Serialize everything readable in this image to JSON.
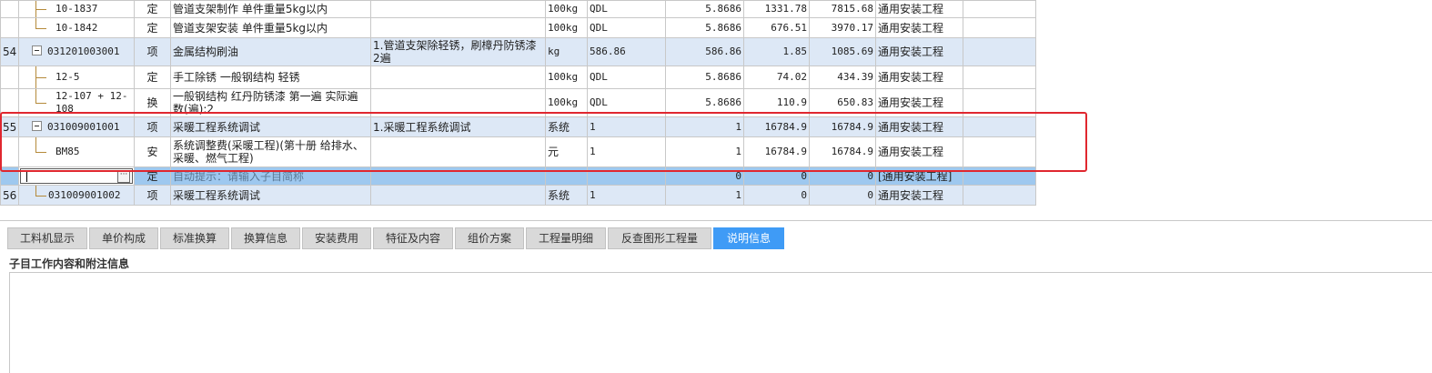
{
  "rows": [
    {
      "no": "",
      "code": "10-1837",
      "kind": "定",
      "name": "管道支架制作 单件重量5kg以内",
      "feature": "",
      "unit": "100kg",
      "expr": "QDL",
      "qty": "5.8686",
      "price": "1331.78",
      "total": "7815.68",
      "category": "通用安装工程"
    },
    {
      "no": "",
      "code": "10-1842",
      "kind": "定",
      "name": "管道支架安装 单件重量5kg以内",
      "feature": "",
      "unit": "100kg",
      "expr": "QDL",
      "qty": "5.8686",
      "price": "676.51",
      "total": "3970.17",
      "category": "通用安装工程"
    },
    {
      "no": "54",
      "code": "031201003001",
      "kind": "项",
      "name": "金属结构刷油",
      "feature": "1.管道支架除轻锈，刷樟丹防锈漆2遍",
      "unit": "kg",
      "expr": "586.86",
      "qty": "586.86",
      "price": "1.85",
      "total": "1085.69",
      "category": "通用安装工程"
    },
    {
      "no": "",
      "code": "12-5",
      "kind": "定",
      "name": "手工除锈 一般钢结构 轻锈",
      "feature": "",
      "unit": "100kg",
      "expr": "QDL",
      "qty": "5.8686",
      "price": "74.02",
      "total": "434.39",
      "category": "通用安装工程"
    },
    {
      "no": "",
      "code": "12-107 + 12-108",
      "kind": "换",
      "name": "一般钢结构 红丹防锈漆 第一遍  实际遍数(遍):2",
      "feature": "",
      "unit": "100kg",
      "expr": "QDL",
      "qty": "5.8686",
      "price": "110.9",
      "total": "650.83",
      "category": "通用安装工程"
    },
    {
      "no": "55",
      "code": "031009001001",
      "kind": "项",
      "name": "采暖工程系统调试",
      "feature": "1.采暖工程系统调试",
      "unit": "系统",
      "expr": "1",
      "qty": "1",
      "price": "16784.9",
      "total": "16784.9",
      "category": "通用安装工程"
    },
    {
      "no": "",
      "code": "BM85",
      "kind": "安",
      "name": "系统调整费(采暖工程)(第十册 给排水、采暖、燃气工程)",
      "feature": "",
      "unit": "元",
      "expr": "1",
      "qty": "1",
      "price": "16784.9",
      "total": "16784.9",
      "category": "通用安装工程"
    },
    {
      "no": "",
      "code": "",
      "kind": "定",
      "name": "自动提示：请输入子目简称",
      "feature": "",
      "unit": "",
      "expr": "",
      "qty": "0",
      "price": "0",
      "total": "0",
      "category": "[通用安装工程]"
    },
    {
      "no": "56",
      "code": "031009001002",
      "kind": "项",
      "name": "采暖工程系统调试",
      "feature": "",
      "unit": "系统",
      "expr": "1",
      "qty": "1",
      "price": "0",
      "total": "0",
      "category": "通用安装工程"
    }
  ],
  "tabs": [
    "工料机显示",
    "单价构成",
    "标准换算",
    "换算信息",
    "安装费用",
    "特征及内容",
    "组价方案",
    "工程量明细",
    "反查图形工程量",
    "说明信息"
  ],
  "active_tab": "说明信息",
  "panel_title": "子目工作内容和附注信息",
  "edit_button_glyph": "···",
  "colors": {
    "highlight_border": "#e0272f",
    "active_tab": "#3f9bf6",
    "summary_row": "#dde8f6",
    "edit_row": "#9ec8ef"
  }
}
